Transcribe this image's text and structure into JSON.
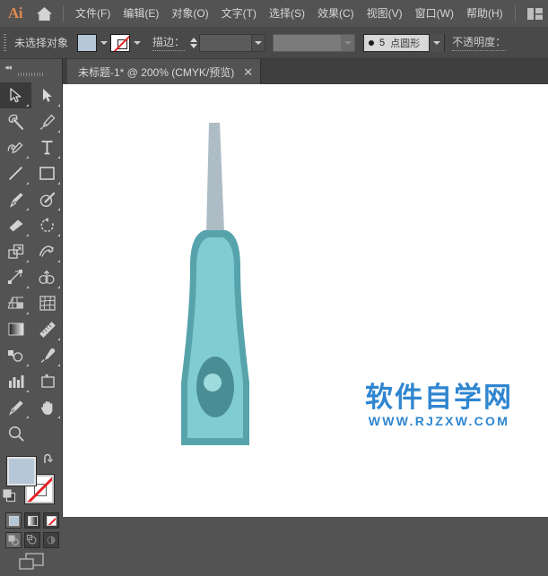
{
  "app": {
    "name": "Ai",
    "logo_color": "#e08a52",
    "home_icon": "home-icon",
    "workspace_icon": "workspace-switcher-icon"
  },
  "menubar": {
    "items": [
      {
        "label": "文件(F)",
        "name": "menu-file"
      },
      {
        "label": "编辑(E)",
        "name": "menu-edit"
      },
      {
        "label": "对象(O)",
        "name": "menu-object"
      },
      {
        "label": "文字(T)",
        "name": "menu-type"
      },
      {
        "label": "选择(S)",
        "name": "menu-select"
      },
      {
        "label": "效果(C)",
        "name": "menu-effect"
      },
      {
        "label": "视图(V)",
        "name": "menu-view"
      },
      {
        "label": "窗口(W)",
        "name": "menu-window"
      },
      {
        "label": "帮助(H)",
        "name": "menu-help"
      }
    ]
  },
  "controlbar": {
    "selection_label": "未选择对象",
    "fill_color": "#b6c8d8",
    "stroke_value": "none",
    "stroke_label": "描边：",
    "stroke_weight_value": "",
    "profile_value": "",
    "brush": {
      "size": "5",
      "name": "点圆形"
    },
    "opacity_label": "不透明度："
  },
  "tabbar": {
    "tab_title": "未标题-1* @ 200% (CMYK/预览)",
    "close_label": "✕"
  },
  "toolpanel": {
    "collapse_label": "◂◂",
    "tools": [
      {
        "name": "selection-tool",
        "label": "选择工具",
        "active": true
      },
      {
        "name": "direct-selection-tool",
        "label": "直接选择工具",
        "active": false
      },
      {
        "name": "magic-wand-tool",
        "label": "魔棒工具",
        "active": false
      },
      {
        "name": "pen-tool",
        "label": "钢笔工具",
        "active": false
      },
      {
        "name": "curvature-tool",
        "label": "曲率工具",
        "active": false
      },
      {
        "name": "type-tool",
        "label": "文字工具",
        "active": false
      },
      {
        "name": "line-segment-tool",
        "label": "直线段工具",
        "active": false
      },
      {
        "name": "rectangle-tool",
        "label": "矩形工具",
        "active": false
      },
      {
        "name": "paintbrush-tool",
        "label": "画笔工具",
        "active": false
      },
      {
        "name": "shaper-tool",
        "label": "Shaper 工具",
        "active": false
      },
      {
        "name": "eraser-tool",
        "label": "橡皮擦工具",
        "active": false
      },
      {
        "name": "rotate-tool",
        "label": "旋转工具",
        "active": false
      },
      {
        "name": "scale-tool",
        "label": "比例缩放工具",
        "active": false
      },
      {
        "name": "width-tool",
        "label": "宽度工具",
        "active": false
      },
      {
        "name": "free-transform-tool",
        "label": "自由变换工具",
        "active": false
      },
      {
        "name": "shape-builder-tool",
        "label": "形状生成器工具",
        "active": false
      },
      {
        "name": "perspective-grid-tool",
        "label": "透视网格工具",
        "active": false
      },
      {
        "name": "mesh-tool",
        "label": "网格工具",
        "active": false
      },
      {
        "name": "gradient-tool",
        "label": "渐变工具",
        "active": false
      },
      {
        "name": "measure-tool",
        "label": "度量工具",
        "active": false
      },
      {
        "name": "blend-tool",
        "label": "混合工具",
        "active": false
      },
      {
        "name": "eyedropper-tool",
        "label": "吸管工具",
        "active": false
      },
      {
        "name": "column-graph-tool",
        "label": "柱形图工具",
        "active": false
      },
      {
        "name": "artboard-tool",
        "label": "画板工具",
        "active": false
      },
      {
        "name": "slice-tool",
        "label": "切片工具",
        "active": false
      },
      {
        "name": "hand-tool",
        "label": "抓手工具",
        "active": false
      },
      {
        "name": "zoom-tool",
        "label": "缩放工具",
        "active": false
      }
    ],
    "fill_color": "#b6c8d8",
    "stroke_color": "none",
    "swap_icon": "swap-fill-stroke-icon",
    "default_icon": "default-fill-stroke-icon",
    "color_modes": [
      {
        "name": "color-mode-button",
        "selected": true
      },
      {
        "name": "gradient-mode-button",
        "selected": false
      },
      {
        "name": "none-mode-button",
        "selected": false
      }
    ],
    "draw_modes": [
      {
        "name": "draw-normal-button",
        "selected": true
      },
      {
        "name": "draw-behind-button",
        "selected": false
      },
      {
        "name": "draw-inside-button",
        "selected": false
      }
    ],
    "screen_mode_icon": "change-screen-mode-icon"
  },
  "canvas": {
    "background": "#ffffff",
    "artwork": {
      "name": "toothbrush-illustration",
      "bristle_neck_color": "#aebcc6",
      "handle_outer_color": "#56a3ac",
      "handle_inner_color": "#7fcdd1",
      "grip_ellipse_color": "#4a8e95",
      "grip_hole_color": "#9ddbdd"
    },
    "watermark": {
      "text_cn": "软件自学网",
      "text_url": "WWW.RJZXW.COM",
      "color": "#2f86d0"
    }
  }
}
